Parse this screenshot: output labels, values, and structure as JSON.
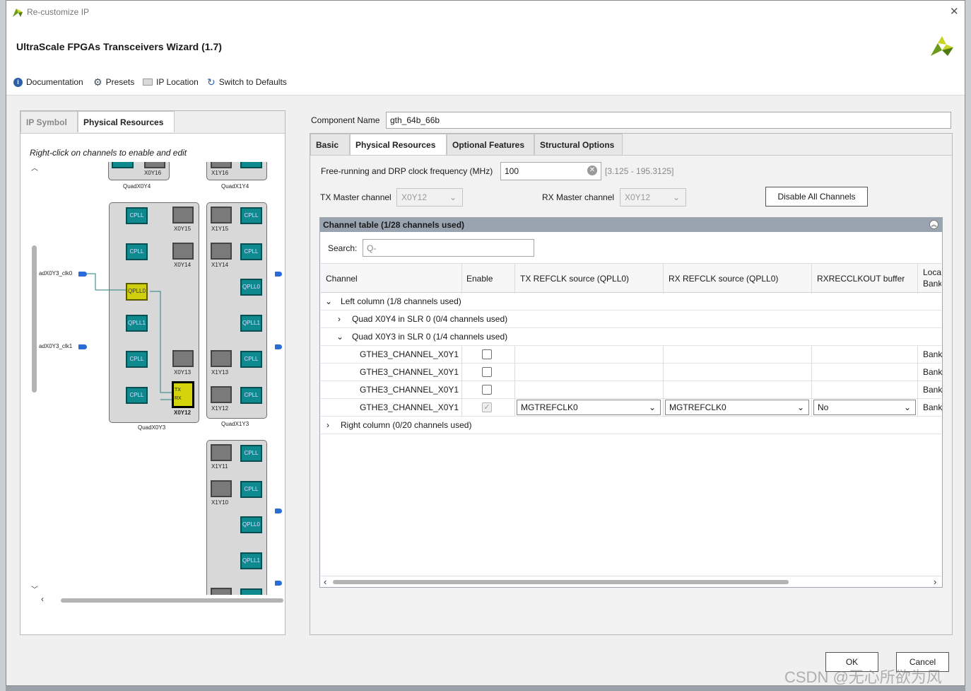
{
  "window": {
    "title": "Re-customize IP",
    "close_glyph": "✕"
  },
  "header": {
    "title": "UltraScale FPGAs Transceivers Wizard (1.7)"
  },
  "toolbar": {
    "documentation": "Documentation",
    "presets": "Presets",
    "ip_location": "IP Location",
    "switch_defaults": "Switch to Defaults"
  },
  "left_panel": {
    "tabs": [
      "IP Symbol",
      "Physical Resources"
    ],
    "active_tab": "Physical Resources",
    "hint": "Right-click on channels to enable and edit",
    "quads": [
      "QuadX0Y4",
      "QuadX1Y4",
      "QuadX0Y3",
      "QuadX1Y3"
    ],
    "channel_labels": [
      "X0Y16",
      "X1Y16",
      "X0Y15",
      "X1Y15",
      "X0Y14",
      "X1Y14",
      "X0Y13",
      "X1Y13",
      "X0Y12",
      "X1Y12",
      "X1Y11",
      "X1Y10"
    ],
    "pll_labels": {
      "cpll": "CPLL",
      "qpll0": "QPLL0",
      "qpll1": "QPLL1",
      "tx": "TX",
      "rx": "RX"
    },
    "refclk_labels": [
      "adX0Y3_clk0",
      "adX0Y3_clk1"
    ]
  },
  "component": {
    "label": "Component Name",
    "value": "gth_64b_66b"
  },
  "right_tabs": [
    "Basic",
    "Physical Resources",
    "Optional Features",
    "Structural Options"
  ],
  "active_right_tab": "Physical Resources",
  "freq": {
    "label": "Free-running and DRP clock frequency (MHz)",
    "value": "100",
    "range": "[3.125 - 195.3125]"
  },
  "tx_master": {
    "label": "TX Master channel",
    "value": "X0Y12"
  },
  "rx_master": {
    "label": "RX Master channel",
    "value": "X0Y12"
  },
  "disable_all": "Disable All Channels",
  "channel_table": {
    "title": "Channel table (1/28 channels used)",
    "search_label": "Search:",
    "search_placeholder": "Q-",
    "columns": [
      "Channel",
      "Enable",
      "TX REFCLK source (QPLL0)",
      "RX REFCLK source (QPLL0)",
      "RXRECCLKOUT buffer",
      "Loca\nBank"
    ],
    "groups": {
      "left": "Left column (1/8 channels used)",
      "quad_x0y4": "Quad X0Y4 in SLR 0 (0/4 channels used)",
      "quad_x0y3": "Quad X0Y3 in SLR 0 (1/4 channels used)",
      "right": "Right column (0/20 channels used)"
    },
    "rows": [
      {
        "channel": "GTHE3_CHANNEL_X0Y1",
        "enabled": false,
        "tx_refclk": "",
        "rx_refclk": "",
        "recclk": "",
        "bank": "Bank"
      },
      {
        "channel": "GTHE3_CHANNEL_X0Y1",
        "enabled": false,
        "tx_refclk": "",
        "rx_refclk": "",
        "recclk": "",
        "bank": "Bank"
      },
      {
        "channel": "GTHE3_CHANNEL_X0Y1",
        "enabled": false,
        "tx_refclk": "",
        "rx_refclk": "",
        "recclk": "",
        "bank": "Bank"
      },
      {
        "channel": "GTHE3_CHANNEL_X0Y1",
        "enabled": true,
        "tx_refclk": "MGTREFCLK0",
        "rx_refclk": "MGTREFCLK0",
        "recclk": "No",
        "bank": "Bank"
      }
    ]
  },
  "footer": {
    "ok": "OK",
    "cancel": "Cancel"
  },
  "watermark": "CSDN @无心所欲为风",
  "colors": {
    "accent": "#2a6cd6",
    "channel_teal": "#0e8a8f",
    "selected_yellow": "#d4d40a"
  }
}
